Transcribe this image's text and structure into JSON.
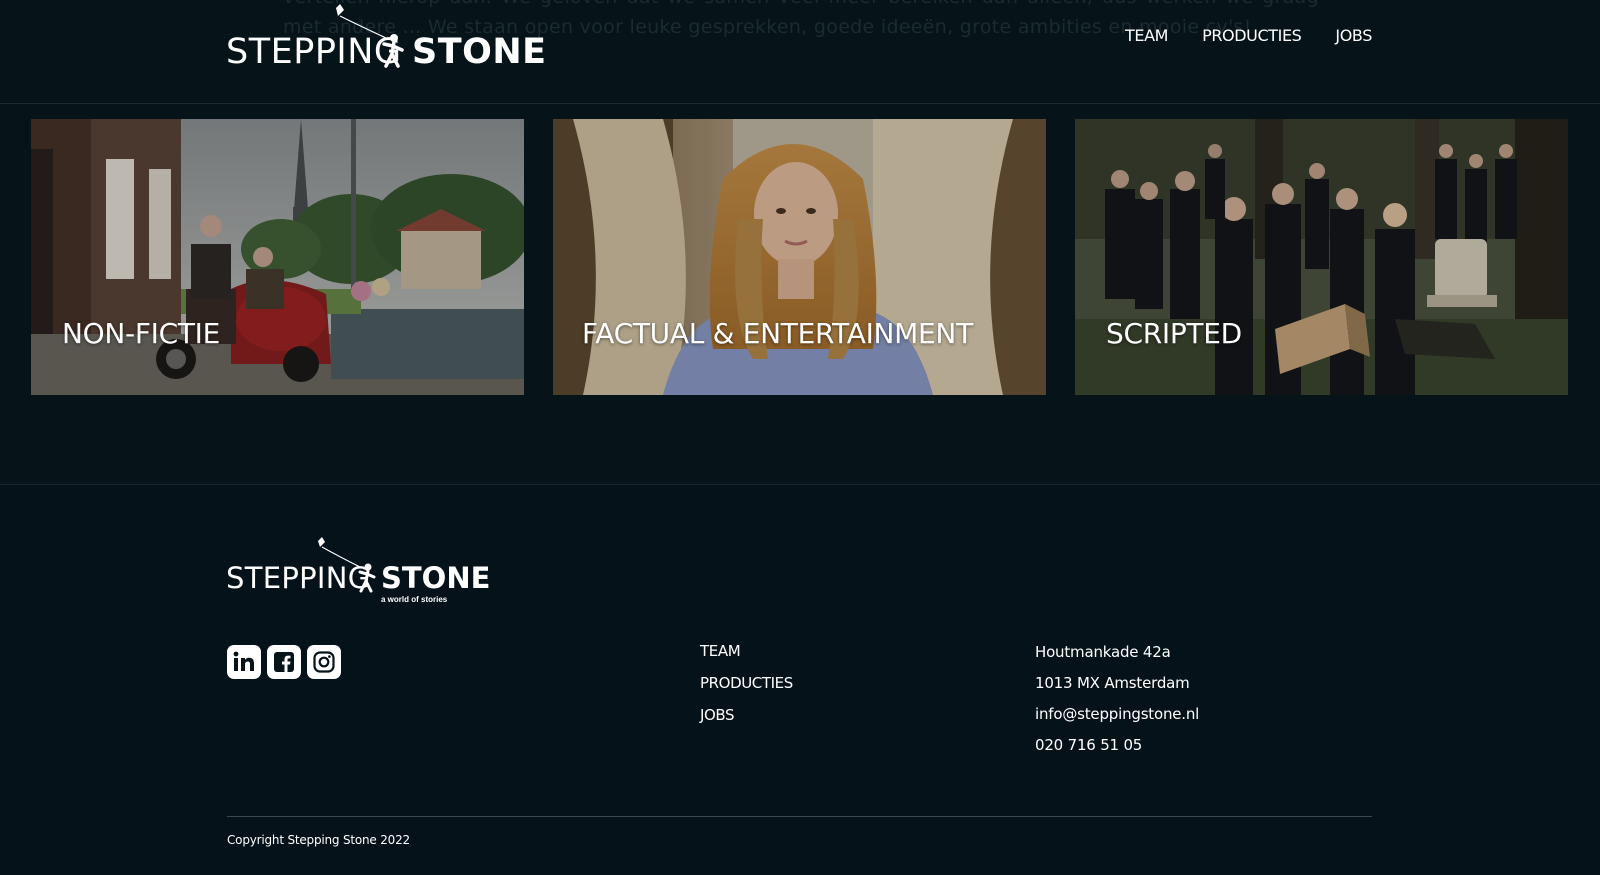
{
  "header": {
    "background_text": "vertellen hierop aan. We geloven dat we samen veel meer bereiken dan alleen, dus werken we graag met andere ... We staan open voor leuke gesprekken, goede ideeën, grote ambities en mooie cv's!",
    "logo": {
      "light": "STEPPING",
      "bold": "STONE"
    },
    "nav": [
      "TEAM",
      "PRODUCTIES",
      "JOBS"
    ]
  },
  "tiles": [
    {
      "label": "NON-FICTIE"
    },
    {
      "label": "FACTUAL & ENTERTAINMENT"
    },
    {
      "label": "SCRIPTED"
    }
  ],
  "footer": {
    "logo": {
      "light": "STEPPING",
      "bold": "STONE",
      "tagline": "a world of stories"
    },
    "social": [
      "linkedin-icon",
      "facebook-icon",
      "instagram-icon"
    ],
    "nav": [
      "TEAM",
      "PRODUCTIES",
      "JOBS"
    ],
    "contact": {
      "address1": "Houtmankade 42a",
      "address2": "1013 MX Amsterdam",
      "email": "info@steppingstone.nl",
      "phone": "020 716 51 05"
    },
    "copyright": "Copyright Stepping Stone 2022"
  },
  "colors": {
    "background": "#061318",
    "text": "#ffffff",
    "divider": "#3a4a4e"
  }
}
